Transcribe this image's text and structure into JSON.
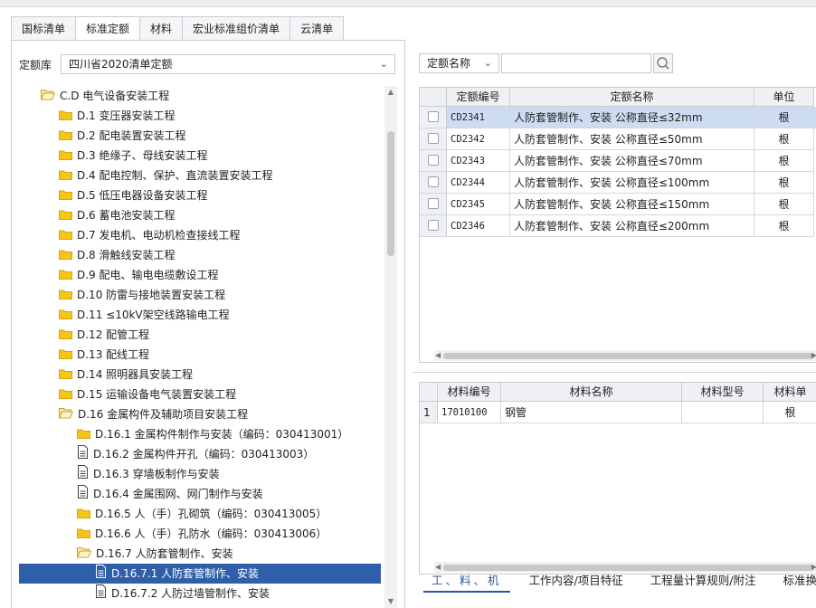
{
  "tabs": [
    "国标清单",
    "标准定额",
    "材料",
    "宏业标准组价清单",
    "云清单"
  ],
  "active_tab": 1,
  "left": {
    "db_label": "定额库",
    "db_value": "四川省2020清单定额"
  },
  "tree": [
    {
      "label": "C.D 电气设备安装工程",
      "icon": "folder-open",
      "level": 1
    },
    {
      "label": "D.1 变压器安装工程",
      "icon": "folder",
      "level": 2
    },
    {
      "label": "D.2 配电装置安装工程",
      "icon": "folder",
      "level": 2
    },
    {
      "label": "D.3 绝缘子、母线安装工程",
      "icon": "folder",
      "level": 2
    },
    {
      "label": "D.4 配电控制、保护、直流装置安装工程",
      "icon": "folder",
      "level": 2
    },
    {
      "label": "D.5 低压电器设备安装工程",
      "icon": "folder",
      "level": 2
    },
    {
      "label": "D.6 蓄电池安装工程",
      "icon": "folder",
      "level": 2
    },
    {
      "label": "D.7 发电机、电动机检查接线工程",
      "icon": "folder",
      "level": 2
    },
    {
      "label": "D.8 滑触线安装工程",
      "icon": "folder",
      "level": 2
    },
    {
      "label": "D.9 配电、输电电缆敷设工程",
      "icon": "folder",
      "level": 2
    },
    {
      "label": "D.10 防雷与接地装置安装工程",
      "icon": "folder",
      "level": 2
    },
    {
      "label": "D.11 ≤10kV架空线路输电工程",
      "icon": "folder",
      "level": 2
    },
    {
      "label": "D.12 配管工程",
      "icon": "folder",
      "level": 2
    },
    {
      "label": "D.13 配线工程",
      "icon": "folder",
      "level": 2
    },
    {
      "label": "D.14 照明器具安装工程",
      "icon": "folder",
      "level": 2
    },
    {
      "label": "D.15 运输设备电气装置安装工程",
      "icon": "folder",
      "level": 2
    },
    {
      "label": "D.16 金属构件及辅助项目安装工程",
      "icon": "folder-open",
      "level": 2
    },
    {
      "label": "D.16.1 金属构件制作与安装（编码：030413001）",
      "icon": "folder",
      "level": 3
    },
    {
      "label": "D.16.2 金属构件开孔（编码：030413003）",
      "icon": "doc",
      "level": 3
    },
    {
      "label": "D.16.3 穿墙板制作与安装",
      "icon": "doc",
      "level": 3
    },
    {
      "label": "D.16.4 金属围网、网门制作与安装",
      "icon": "doc",
      "level": 3
    },
    {
      "label": "D.16.5 人（手）孔砌筑（编码：030413005）",
      "icon": "folder",
      "level": 3
    },
    {
      "label": "D.16.6 人（手）孔防水（编码：030413006）",
      "icon": "folder",
      "level": 3
    },
    {
      "label": "D.16.7 人防套管制作、安装",
      "icon": "folder-open",
      "level": 3
    },
    {
      "label": "D.16.7.1 人防套管制作、安装",
      "icon": "doc",
      "level": 4,
      "selected": true
    },
    {
      "label": "D.16.7.2 人防过墙管制作、安装",
      "icon": "doc",
      "level": 4
    }
  ],
  "search": {
    "field_label": "定额名称",
    "value": ""
  },
  "quota_table": {
    "headers": [
      "定额编号",
      "定额名称",
      "单位"
    ],
    "rows": [
      {
        "code": "CD2341",
        "name": "人防套管制作、安装 公称直径≤32mm",
        "unit": "根",
        "selected": true
      },
      {
        "code": "CD2342",
        "name": "人防套管制作、安装 公称直径≤50mm",
        "unit": "根"
      },
      {
        "code": "CD2343",
        "name": "人防套管制作、安装 公称直径≤70mm",
        "unit": "根"
      },
      {
        "code": "CD2344",
        "name": "人防套管制作、安装 公称直径≤100mm",
        "unit": "根"
      },
      {
        "code": "CD2345",
        "name": "人防套管制作、安装 公称直径≤150mm",
        "unit": "根"
      },
      {
        "code": "CD2346",
        "name": "人防套管制作、安装 公称直径≤200mm",
        "unit": "根"
      }
    ]
  },
  "material_table": {
    "headers": [
      "材料编号",
      "材料名称",
      "材料型号",
      "材料单"
    ],
    "rows": [
      {
        "no": "1",
        "code": "17010100",
        "name": "钢管",
        "model": "",
        "unit": "根"
      }
    ]
  },
  "bottom_tabs": [
    "工、料、机",
    "工作内容/项目特征",
    "工程量计算规则/附注",
    "标准换算"
  ],
  "active_bottom_tab": 0,
  "colors": {
    "selection": "#2f5fa8",
    "row_highlight": "#cddcf1",
    "accent": "#2c56a0",
    "folder": "#f5c518"
  }
}
